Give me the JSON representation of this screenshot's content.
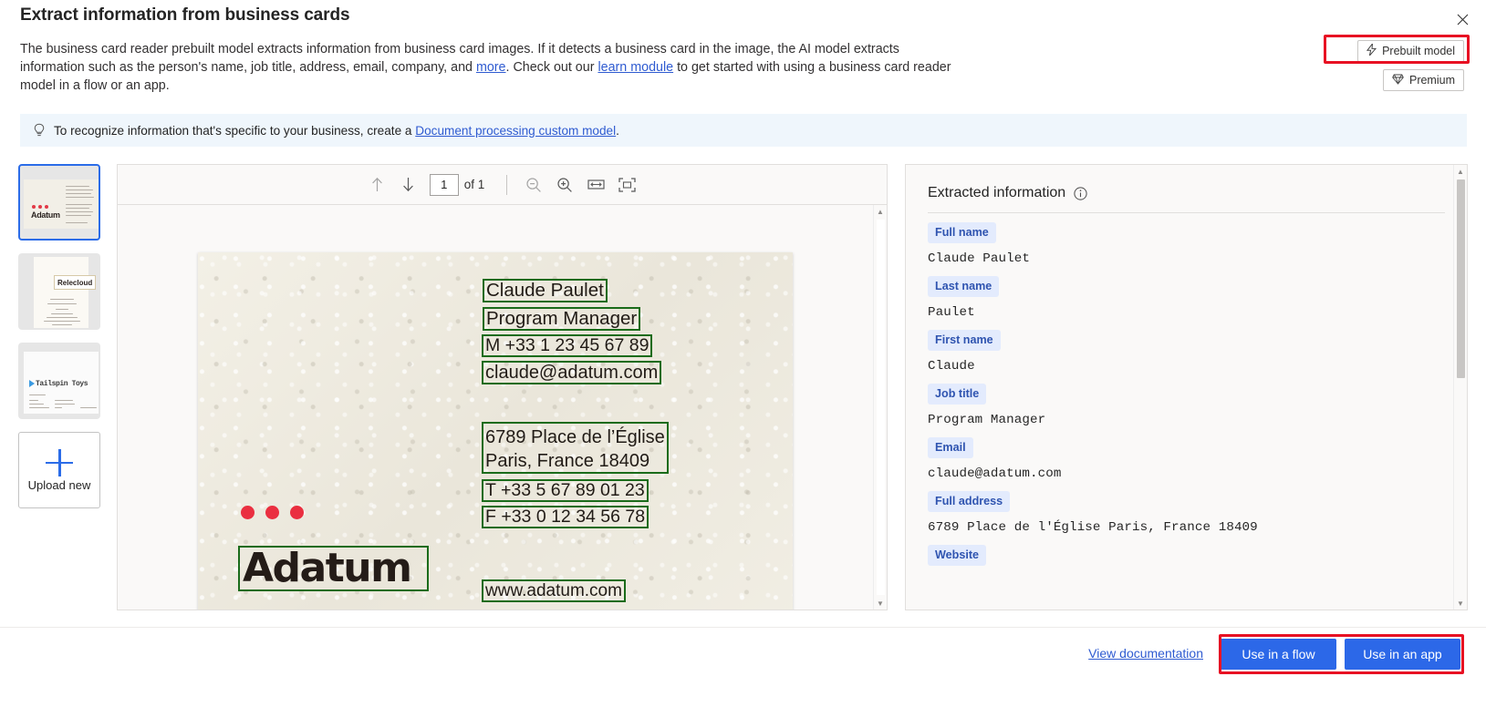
{
  "dialog": {
    "title": "Extract information from business cards",
    "close_icon": "close-icon"
  },
  "intro": {
    "part1": "The business card reader prebuilt model extracts information from business card images. If it detects a business card in the image, the AI model extracts information such as the person's name, job title, address, email, company, and ",
    "link_more": "more",
    "part2": ". Check out our ",
    "link_learn": "learn module",
    "part3": " to get started with using a business card reader model in a flow or an app."
  },
  "badges": {
    "prebuilt": {
      "label": "Prebuilt model",
      "icon": "lightning-bolt-icon"
    },
    "premium": {
      "label": "Premium",
      "icon": "diamond-icon"
    }
  },
  "banner": {
    "icon": "lightbulb-icon",
    "text_before": "To recognize information that's specific to your business, create a ",
    "link": "Document processing custom model",
    "text_after": "."
  },
  "thumbnails": {
    "items": [
      {
        "name": "Adatum",
        "selected": true
      },
      {
        "name": "Relecloud",
        "selected": false
      },
      {
        "name": "Tailspin Toys",
        "selected": false
      }
    ],
    "upload": {
      "label": "Upload new",
      "icon": "plus-icon"
    }
  },
  "viewer": {
    "toolbar": {
      "prev_icon": "arrow-up-icon",
      "next_icon": "arrow-down-icon",
      "page_value": "1",
      "page_total_label": "of 1",
      "zoom_out_icon": "zoom-out-icon",
      "zoom_in_icon": "zoom-in-icon",
      "fit_width_icon": "fit-width-icon",
      "fit_page_icon": "fit-page-icon"
    },
    "card": {
      "brand": "Adatum",
      "ocr_lines": [
        "Claude Paulet",
        "Program Manager",
        "M +33 1 23 45 67 89",
        "claude@adatum.com",
        "6789 Place de l’Église",
        "Paris, France 18409",
        "T +33 5 67 89 01 23",
        "F +33 0 12 34 56 78",
        "www.adatum.com"
      ],
      "address_line1": "6789 Place de l’Église",
      "address_line2": "Paris, France 18409",
      "phone": "M +33 1 23 45 67 89",
      "tel": "T +33 5 67 89 01 23",
      "fax": "F +33 0 12 34 56 78",
      "website": "www.adatum.com",
      "email": "claude@adatum.com",
      "name": "Claude Paulet",
      "title": "Program Manager"
    }
  },
  "extracted": {
    "heading": "Extracted information",
    "info_icon": "info-circle-icon",
    "fields": [
      {
        "label": "Full name",
        "value": "Claude Paulet"
      },
      {
        "label": "Last name",
        "value": "Paulet"
      },
      {
        "label": "First name",
        "value": "Claude"
      },
      {
        "label": "Job title",
        "value": "Program Manager"
      },
      {
        "label": "Email",
        "value": "claude@adatum.com"
      },
      {
        "label": "Full address",
        "value": "6789 Place de l'Église Paris, France 18409"
      },
      {
        "label": "Website",
        "value": ""
      }
    ]
  },
  "footer": {
    "documentation_link": "View documentation",
    "use_in_flow": "Use in a flow",
    "use_in_app": "Use in an app"
  },
  "colors": {
    "accent": "#2c68e8",
    "link": "#2f5bd1",
    "pill_bg": "#e3ebfd",
    "pill_text": "#2f54b0",
    "banner_bg": "#eff6fc",
    "ocr_box": "#1a6b1a",
    "annotation": "#e81123"
  }
}
